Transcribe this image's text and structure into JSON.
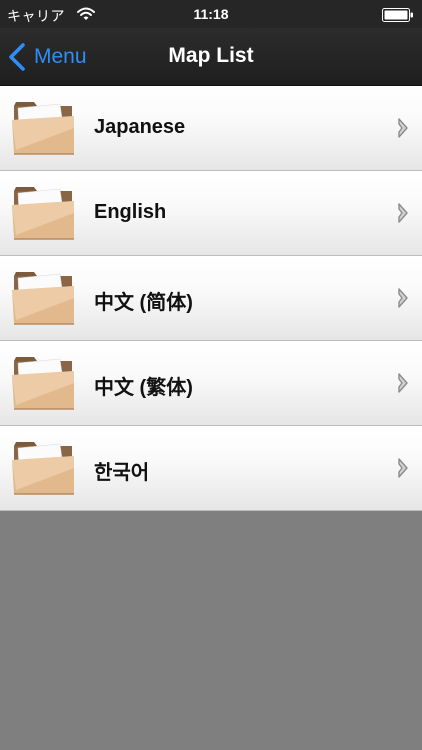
{
  "status_bar": {
    "carrier": "キャリア",
    "time": "11:18",
    "wifi_icon": "wifi-icon",
    "battery_icon": "battery-icon"
  },
  "nav": {
    "back_label": "Menu",
    "back_icon": "chevron-left-icon",
    "title": "Map List",
    "accent_color": "#2f8df7"
  },
  "list": {
    "items": [
      {
        "label": "Japanese",
        "icon": "folder-icon"
      },
      {
        "label": "English",
        "icon": "folder-icon"
      },
      {
        "label": "中文 (简体)",
        "icon": "folder-icon"
      },
      {
        "label": "中文 (繁体)",
        "icon": "folder-icon"
      },
      {
        "label": "한국어",
        "icon": "folder-icon"
      }
    ],
    "disclosure_icon": "chevron-right-icon"
  },
  "colors": {
    "nav_background": "#262626",
    "page_background": "#7f7f7f"
  }
}
